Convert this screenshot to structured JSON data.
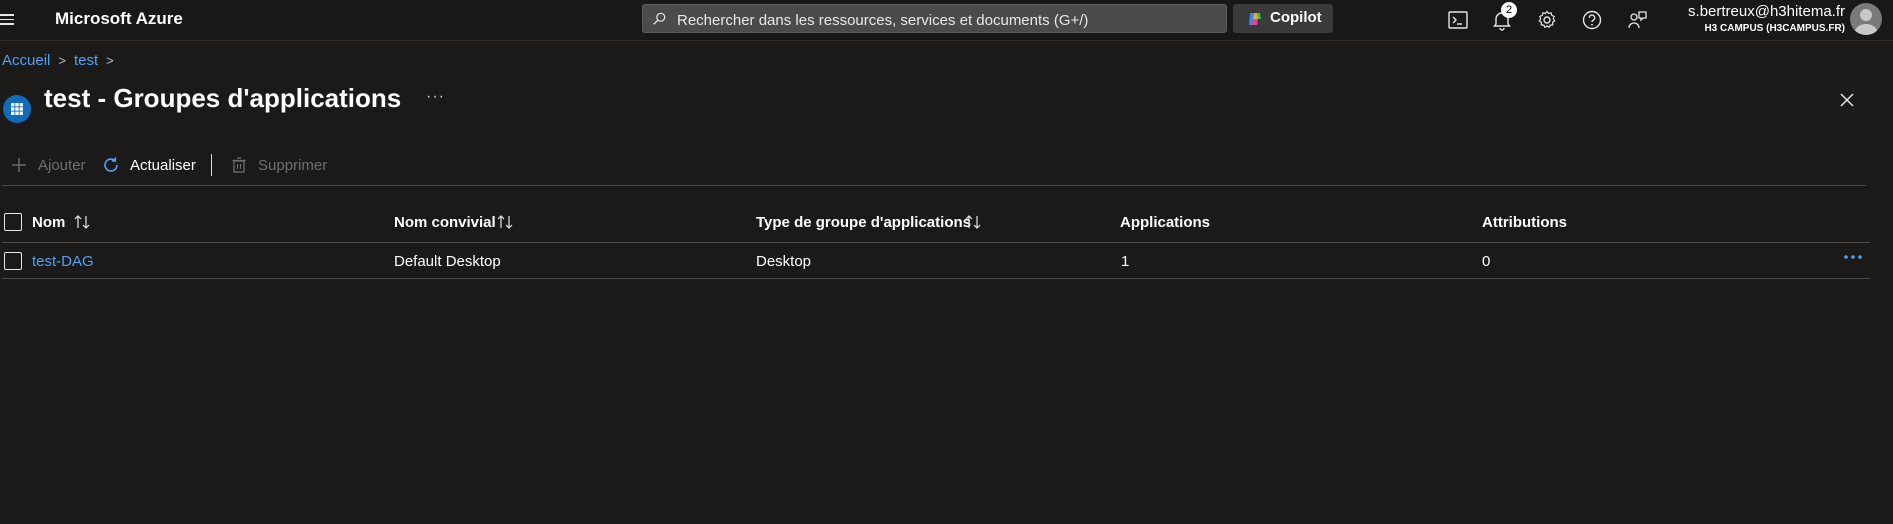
{
  "topbar": {
    "brand": "Microsoft Azure",
    "search_placeholder": "Rechercher dans les ressources, services et documents (G+/)",
    "copilot_label": "Copilot",
    "notification_count": "2",
    "user_email": "s.bertreux@h3hitema.fr",
    "user_tenant": "H3 CAMPUS (H3CAMPUS.FR)",
    "icons": [
      "menu-icon",
      "search-icon",
      "copilot-icon",
      "cloud-shell-icon",
      "bell-icon",
      "gear-icon",
      "help-icon",
      "feedback-icon",
      "avatar"
    ]
  },
  "breadcrumb": [
    "Accueil",
    "test"
  ],
  "page": {
    "title": "test - Groupes d'applications",
    "more": "···"
  },
  "commands": [
    {
      "label": "Ajouter",
      "icon": "plus-icon",
      "enabled": false
    },
    {
      "label": "Actualiser",
      "icon": "refresh-icon",
      "enabled": true
    },
    {
      "label": "Supprimer",
      "icon": "trash-icon",
      "enabled": false
    }
  ],
  "table": {
    "columns": [
      "Nom",
      "Nom convivial",
      "Type de groupe d'applications",
      "Applications",
      "Attributions"
    ],
    "rows": [
      {
        "name": "test-DAG",
        "friendly_name": "Default Desktop",
        "type": "Desktop",
        "applications": "1",
        "assignments": "0"
      }
    ]
  },
  "colors": {
    "background": "#1b1a19",
    "link": "#4ba3f5",
    "accent": "#0f6cbd",
    "disabled": "#6e6e6e"
  }
}
